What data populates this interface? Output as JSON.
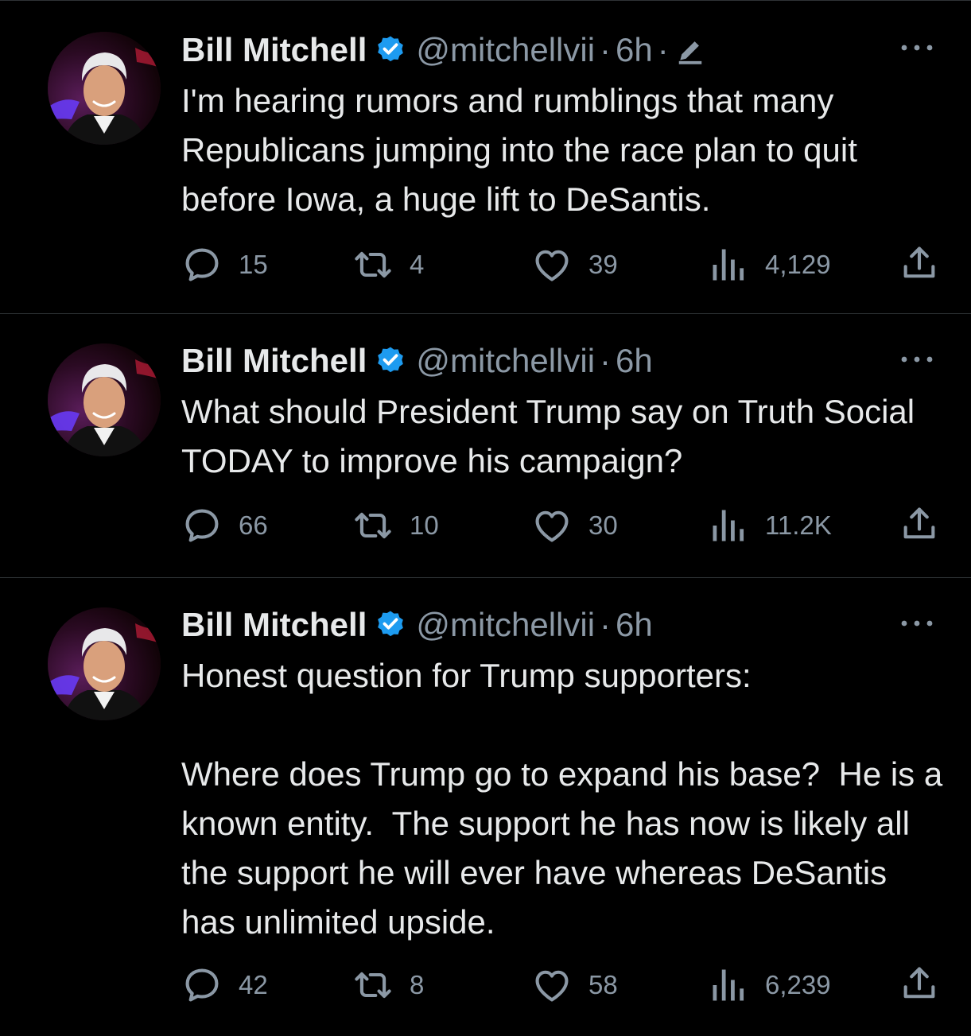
{
  "colors": {
    "background": "#000000",
    "text": "#e7e9ea",
    "muted": "#8b98a5",
    "verified": "#1d9bf0",
    "divider": "#2f3336"
  },
  "tweets": [
    {
      "name": "Bill Mitchell",
      "handle": "@mitchellvii",
      "sep": "·",
      "time": "6h",
      "edited_sep": "·",
      "edited_icon": "pencil-edit-icon",
      "text": "I'm hearing rumors and rumblings that many Republicans jumping into the race plan to quit before Iowa, a huge lift to DeSantis.",
      "replies": "15",
      "retweets": "4",
      "likes": "39",
      "views": "4,129"
    },
    {
      "name": "Bill Mitchell",
      "handle": "@mitchellvii",
      "sep": "·",
      "time": "6h",
      "text": "What should President Trump say on Truth Social TODAY to improve his campaign?",
      "replies": "66",
      "retweets": "10",
      "likes": "30",
      "views": "11.2K"
    },
    {
      "name": "Bill Mitchell",
      "handle": "@mitchellvii",
      "sep": "·",
      "time": "6h",
      "text": "Honest question for Trump supporters:\n\nWhere does Trump go to expand his base?  He is a known entity.  The support he has now is likely all the support he will ever have whereas DeSantis has unlimited upside.",
      "replies": "42",
      "retweets": "8",
      "likes": "58",
      "views": "6,239"
    }
  ]
}
